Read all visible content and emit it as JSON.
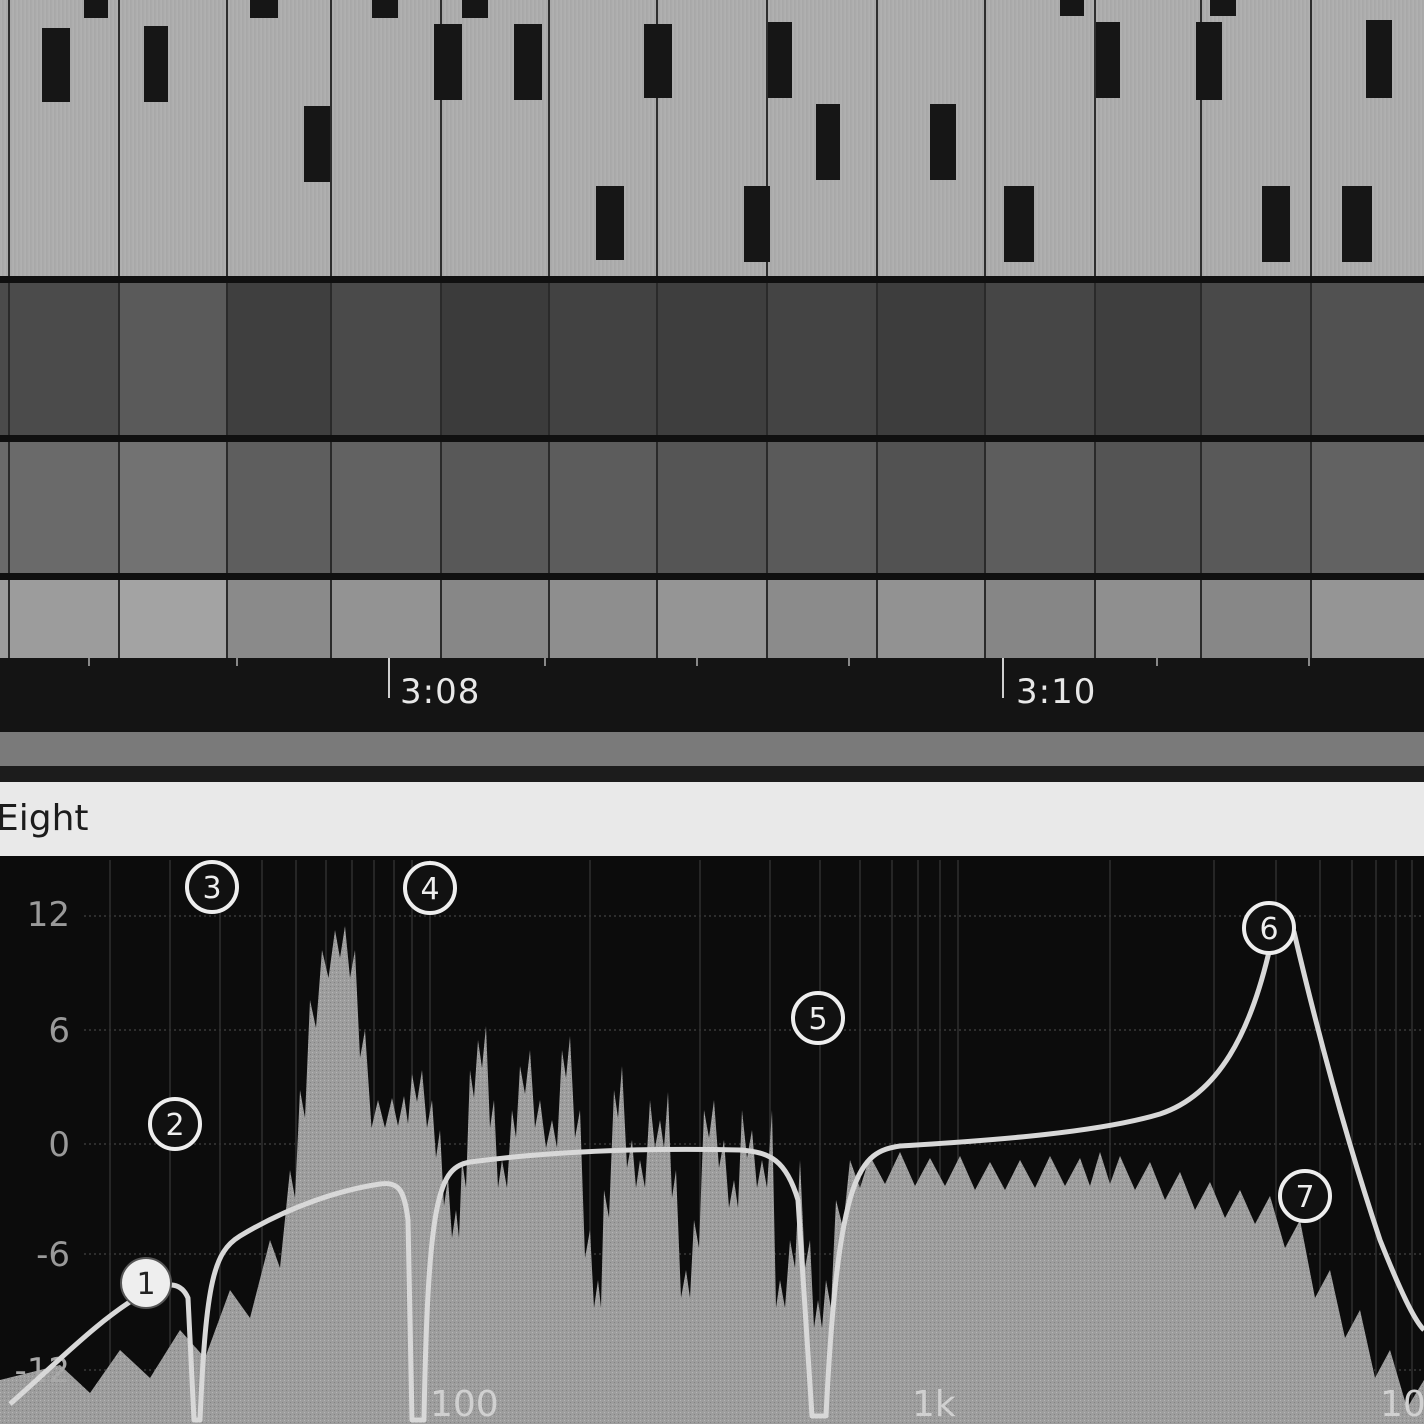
{
  "timeline": {
    "markers": [
      {
        "label": "3:08"
      },
      {
        "label": "3:10"
      }
    ]
  },
  "device": {
    "title": "Eight"
  },
  "eq": {
    "db_labels": [
      "12",
      "6",
      "0",
      "-6",
      "-12"
    ],
    "freq_labels": [
      "100",
      "1k",
      "10"
    ],
    "bands": [
      {
        "number": "1",
        "label": "①",
        "filled": true
      },
      {
        "number": "2",
        "label": "②",
        "filled": false
      },
      {
        "number": "3",
        "label": "③",
        "filled": false
      },
      {
        "number": "4",
        "label": "④",
        "filled": false
      },
      {
        "number": "5",
        "label": "⑤",
        "filled": false
      },
      {
        "number": "6",
        "label": "⑥",
        "filled": false
      },
      {
        "number": "7",
        "label": "⑦",
        "filled": false
      }
    ]
  },
  "colors": {
    "note_lane": "#ababab",
    "note": "#161616",
    "ruler": "#141414",
    "device_header": "#e9e9e9",
    "eq_background": "#0c0c0c",
    "spectrum": "#9a9a9a",
    "eq_curve": "#d8d8d8"
  }
}
